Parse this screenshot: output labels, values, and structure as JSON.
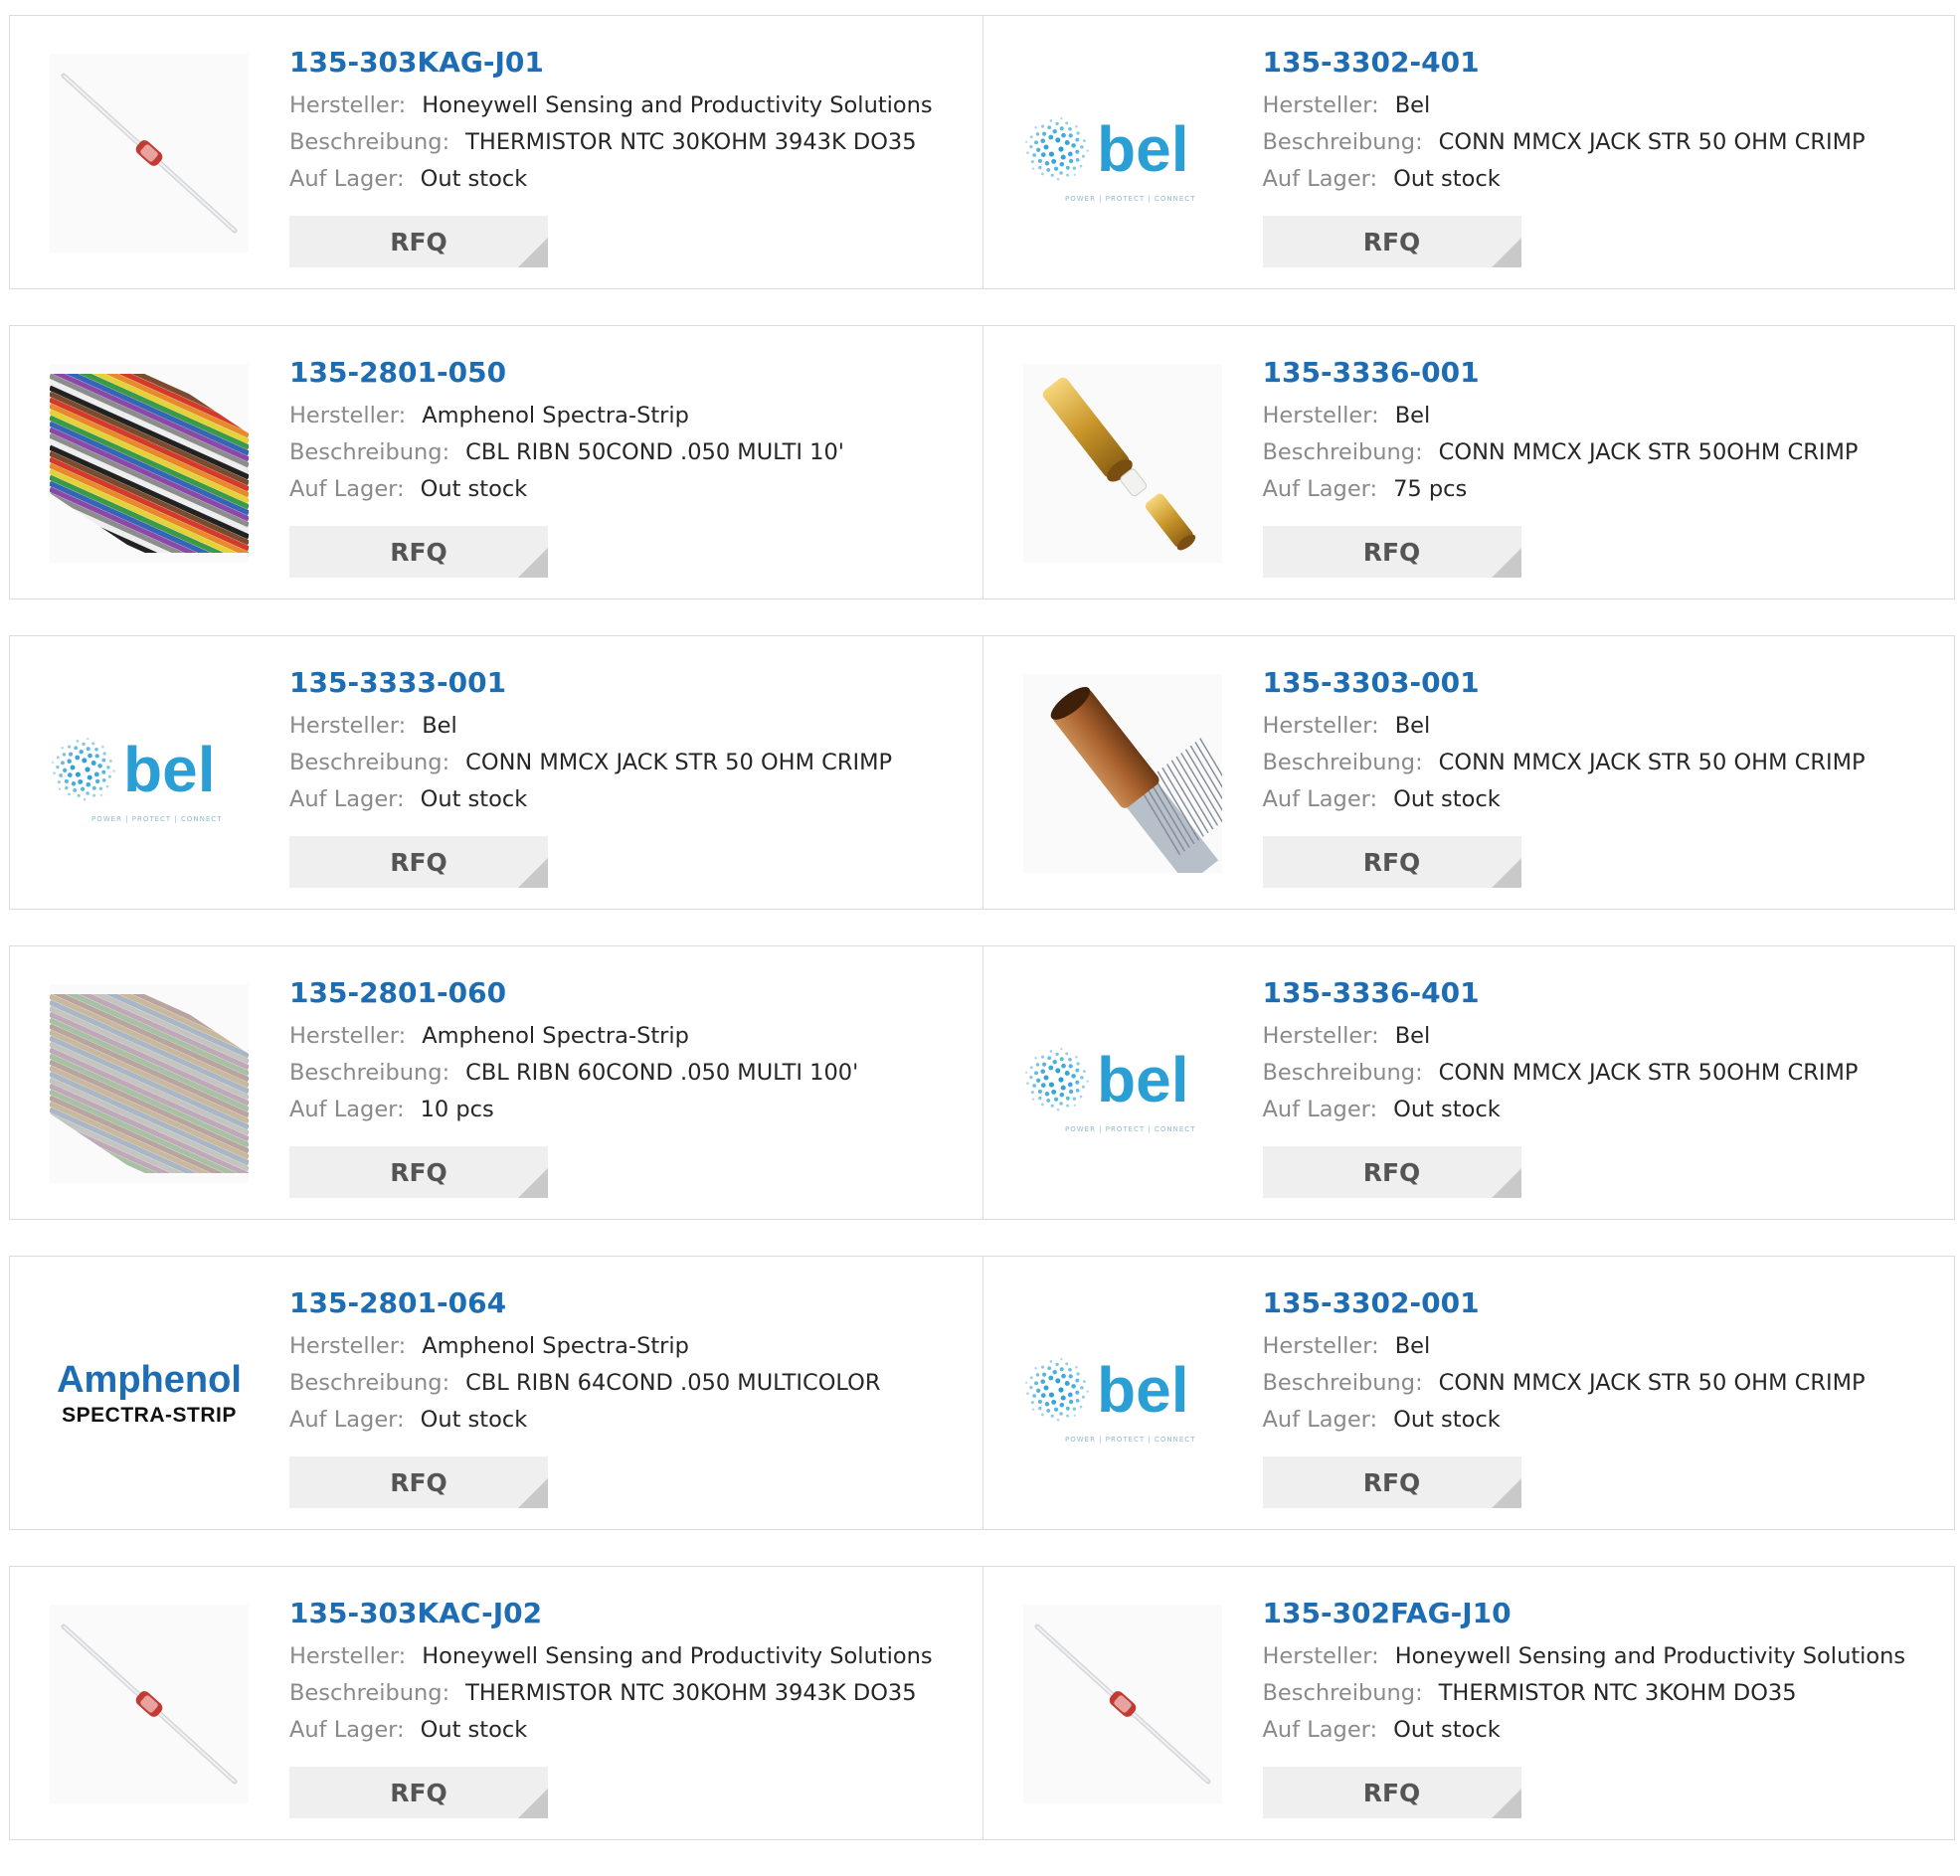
{
  "labels": {
    "manufacturer": "Hersteller:",
    "description": "Beschreibung:",
    "stock": "Auf Lager:",
    "rfq": "RFQ"
  },
  "colors": {
    "part_link": "#1d6db4",
    "label": "#8a8a8a",
    "value": "#262626",
    "rfq_bg": "#efefef",
    "bel_blue": "#2a9fd6",
    "amphenol_blue": "#1d6db4"
  },
  "products": [
    {
      "part": "135-303KAG-J01",
      "manufacturer": "Honeywell Sensing and Productivity Solutions",
      "description": "THERMISTOR NTC 30KOHM 3943K DO35",
      "stock": "Out stock",
      "image": "thermistor-image"
    },
    {
      "part": "135-3302-401",
      "manufacturer": "Bel",
      "description": "CONN MMCX JACK STR 50 OHM CRIMP",
      "stock": "Out stock",
      "image": "bel-logo",
      "logo": {
        "brand": "bel",
        "tagline": "POWER | PROTECT | CONNECT"
      }
    },
    {
      "part": "135-2801-050",
      "manufacturer": "Amphenol Spectra-Strip",
      "description": "CBL RIBN 50COND .050 MULTI 10'",
      "stock": "Out stock",
      "image": "ribbon-cable-image"
    },
    {
      "part": "135-3336-001",
      "manufacturer": "Bel",
      "description": "CONN MMCX JACK STR 50OHM CRIMP",
      "stock": "75 pcs",
      "image": "gold-connector-image"
    },
    {
      "part": "135-3333-001",
      "manufacturer": "Bel",
      "description": "CONN MMCX JACK STR 50 OHM CRIMP",
      "stock": "Out stock",
      "image": "bel-logo",
      "logo": {
        "brand": "bel",
        "tagline": "POWER | PROTECT | CONNECT"
      }
    },
    {
      "part": "135-3303-001",
      "manufacturer": "Bel",
      "description": "CONN MMCX JACK STR 50 OHM CRIMP",
      "stock": "Out stock",
      "image": "crimped-connector-image"
    },
    {
      "part": "135-2801-060",
      "manufacturer": "Amphenol Spectra-Strip",
      "description": "CBL RIBN 60COND .050 MULTI 100'",
      "stock": "10 pcs",
      "image": "ribbon-cable-pale-image"
    },
    {
      "part": "135-3336-401",
      "manufacturer": "Bel",
      "description": "CONN MMCX JACK STR 50OHM CRIMP",
      "stock": "Out stock",
      "image": "bel-logo",
      "logo": {
        "brand": "bel",
        "tagline": "POWER | PROTECT | CONNECT"
      }
    },
    {
      "part": "135-2801-064",
      "manufacturer": "Amphenol Spectra-Strip",
      "description": "CBL RIBN 64COND .050 MULTICOLOR",
      "stock": "Out stock",
      "image": "amphenol-logo",
      "logo": {
        "brand": "Amphenol",
        "sub": "SPECTRA-STRIP"
      }
    },
    {
      "part": "135-3302-001",
      "manufacturer": "Bel",
      "description": "CONN MMCX JACK STR 50 OHM CRIMP",
      "stock": "Out stock",
      "image": "bel-logo",
      "logo": {
        "brand": "bel",
        "tagline": "POWER | PROTECT | CONNECT"
      }
    },
    {
      "part": "135-303KAC-J02",
      "manufacturer": "Honeywell Sensing and Productivity Solutions",
      "description": "THERMISTOR NTC 30KOHM 3943K DO35",
      "stock": "Out stock",
      "image": "thermistor-image"
    },
    {
      "part": "135-302FAG-J10",
      "manufacturer": "Honeywell Sensing and Productivity Solutions",
      "description": "THERMISTOR NTC 3KOHM DO35",
      "stock": "Out stock",
      "image": "thermistor-image"
    }
  ]
}
